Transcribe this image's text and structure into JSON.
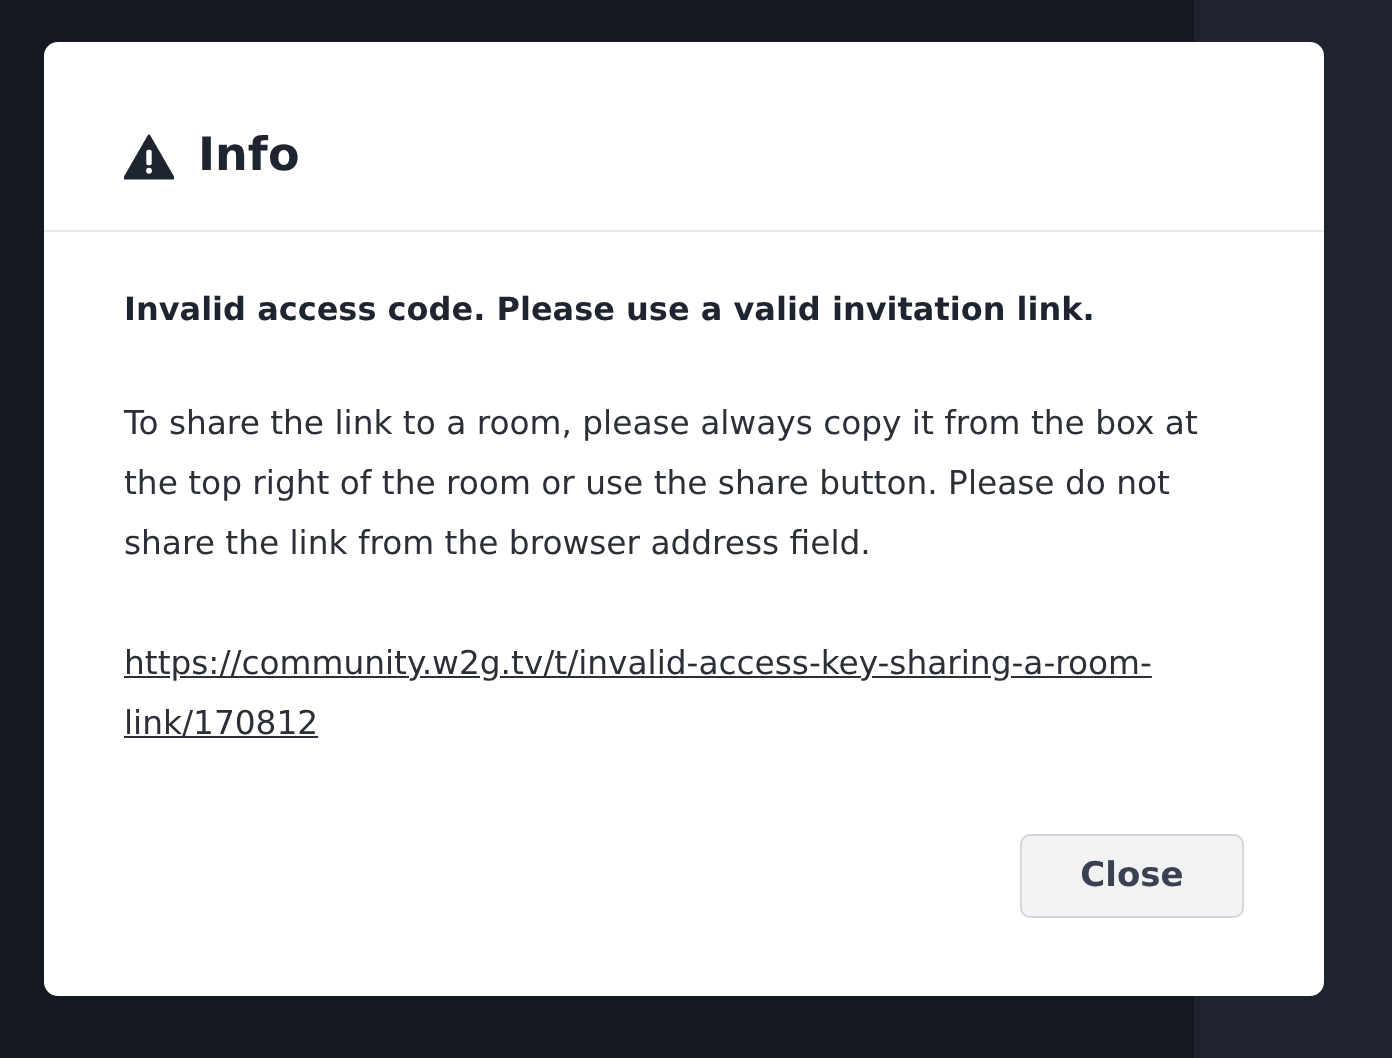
{
  "dialog": {
    "title": "Info",
    "heading": "Invalid access code. Please use a valid invitation link.",
    "message": "To share the link to a room, please always copy it from the box at the top right of the room or use the share button. Please do not share the link from the browser address field.",
    "link": "https://community.w2g.tv/t/invalid-access-key-sharing-a-room-link/170812",
    "buttons": [
      "Close"
    ]
  }
}
